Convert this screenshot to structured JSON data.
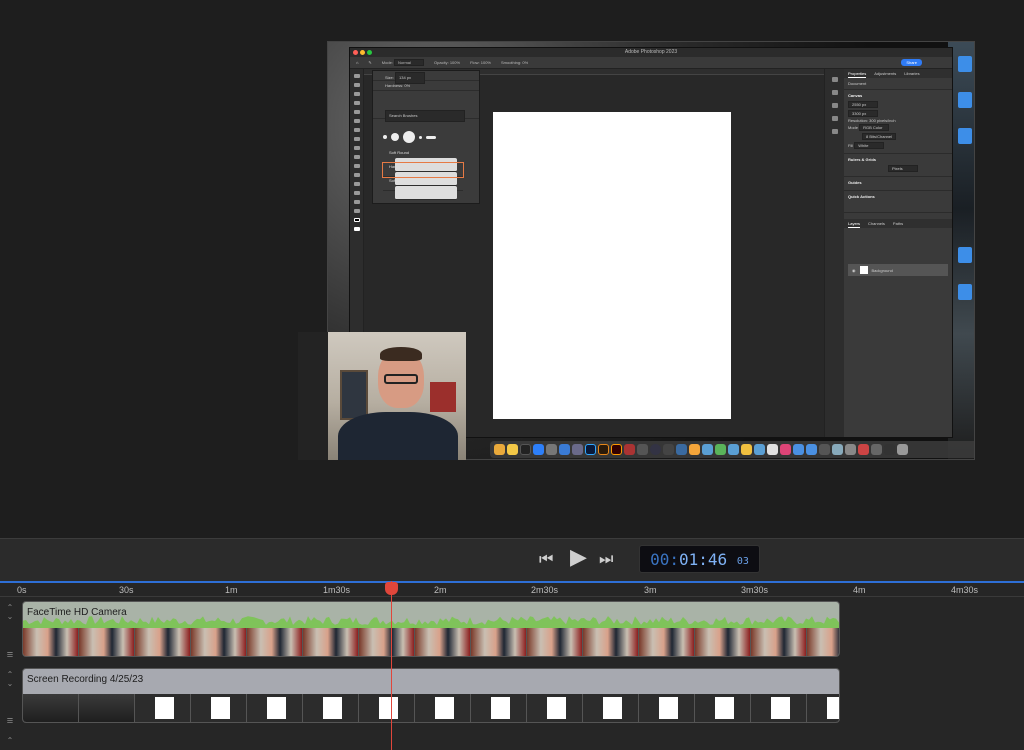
{
  "photoshop": {
    "title": "Adobe Photoshop 2023",
    "share_label": "Share",
    "options": {
      "mode_label": "Mode:",
      "mode_value": "Normal",
      "opacity_label": "Opacity:",
      "opacity_value": "100%",
      "flow_label": "Flow:",
      "flow_value": "100%",
      "smoothing_label": "Smoothing:",
      "smoothing_value": "0%"
    },
    "brush_panel": {
      "size_label": "Size:",
      "size_value": "134 px",
      "hardness_label": "Hardness:",
      "hardness_value": "0%",
      "search_placeholder": "Search Brushes",
      "brushes": [
        "Soft Round",
        "Hard Round",
        "Soft Round Pres..."
      ]
    },
    "properties": {
      "tabs": [
        "Properties",
        "Adjustments",
        "Libraries"
      ],
      "document_label": "Document",
      "canvas_heading": "Canvas",
      "width_value": "2550 px",
      "height_value": "3300 px",
      "resolution": "Resolution: 300 pixels/inch",
      "mode_label": "Mode",
      "mode_value": "RGB Color",
      "bits_value": "8 Bits/Channel",
      "fill_label": "Fill",
      "fill_value": "White",
      "rulers_heading": "Rulers & Grids",
      "units_value": "Pixels",
      "guides_heading": "Guides",
      "quick_actions_heading": "Quick Actions"
    },
    "layers": {
      "tabs": [
        "Layers",
        "Channels",
        "Paths"
      ],
      "background_layer": "Background"
    }
  },
  "transport": {
    "timecode_dim": "00:",
    "timecode_main": "01:46",
    "timecode_frames": "03"
  },
  "timeline": {
    "ruler_labels": [
      "0s",
      "30s",
      "1m",
      "1m30s",
      "2m",
      "2m30s",
      "3m",
      "3m30s",
      "4m",
      "4m30s"
    ],
    "tracks": [
      {
        "label": "FaceTime HD Camera"
      },
      {
        "label": "Screen Recording 4/25/23"
      }
    ],
    "playhead_seconds": 106.1
  },
  "colors": {
    "accent_blue": "#2e6fd6",
    "playhead_red": "#e0463b",
    "timecode_blue": "#7fb2f5"
  },
  "icons": {
    "rewind": "rewind-icon",
    "play": "play-icon",
    "fast_forward": "fast-forward-icon"
  }
}
